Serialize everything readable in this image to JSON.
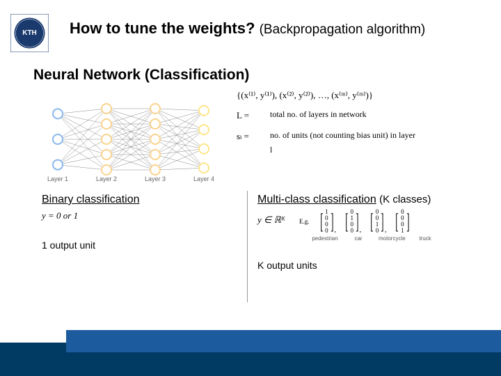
{
  "title_main": "How to tune the weights?",
  "title_sub": "(Backpropagation algorithm)",
  "section_heading": "Neural Network (Classification)",
  "layers": [
    "Layer 1",
    "Layer 2",
    "Layer 3",
    "Layer 4"
  ],
  "nn_structure": {
    "layers": [
      3,
      5,
      5,
      4
    ],
    "colors": [
      "#87b7f0",
      "#fbd38d",
      "#fbd38d",
      "#fde68a"
    ]
  },
  "defs": {
    "dataset": "{(x⁽¹⁾, y⁽¹⁾), (x⁽²⁾, y⁽²⁾), …, (x⁽ᵐ⁾, y⁽ᵐ⁾)}",
    "L_lhs": "L =",
    "L_rhs": "total no. of layers in network",
    "sl_lhs": "sₗ =",
    "sl_rhs": "no. of units (not counting bias unit) in layer l"
  },
  "binary": {
    "heading": "Binary classification",
    "eq": "y = 0 or 1",
    "output": "1 output unit"
  },
  "multi": {
    "heading": "Multi-class classification",
    "heading_sub": "(K classes)",
    "eq_lhs": "y ∈ ℝᴷ",
    "eg": "E.g.",
    "vectors": [
      [
        1,
        0,
        0,
        0
      ],
      [
        0,
        1,
        0,
        0
      ],
      [
        0,
        0,
        1,
        0
      ],
      [
        0,
        0,
        0,
        1
      ]
    ],
    "labels": [
      "pedestrian",
      "car",
      "motorcycle",
      "truck"
    ],
    "output": "K output units"
  },
  "logo_text": "KTH"
}
